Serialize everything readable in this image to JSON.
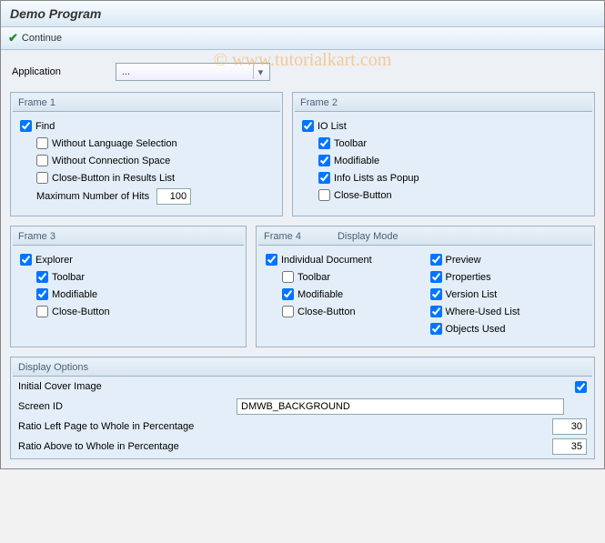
{
  "window_title": "Demo Program",
  "toolbar": {
    "continue_label": "Continue"
  },
  "watermark": "© www.tutorialkart.com",
  "app_row": {
    "label": "Application",
    "value": "..."
  },
  "frame1": {
    "title": "Frame 1",
    "find": "Find",
    "wo_lang": "Without Language Selection",
    "wo_conn": "Without Connection Space",
    "close_results": "Close-Button in Results List",
    "max_hits_label": "Maximum Number of Hits",
    "max_hits_value": "100"
  },
  "frame2": {
    "title": "Frame 2",
    "io_list": "IO List",
    "toolbar": "Toolbar",
    "modifiable": "Modifiable",
    "info_popup": "Info Lists as Popup",
    "close": "Close-Button"
  },
  "frame3": {
    "title": "Frame 3",
    "explorer": "Explorer",
    "toolbar": "Toolbar",
    "modifiable": "Modifiable",
    "close": "Close-Button"
  },
  "frame4": {
    "title": "Frame 4",
    "title2": "Display Mode",
    "indiv_doc": "Individual Document",
    "toolbar": "Toolbar",
    "modifiable": "Modifiable",
    "close": "Close-Button",
    "preview": "Preview",
    "properties": "Properties",
    "version_list": "Version List",
    "where_used": "Where-Used List",
    "objects_used": "Objects Used"
  },
  "display_options": {
    "title": "Display Options",
    "initial_cover": "Initial Cover Image",
    "screen_id_label": "Screen ID",
    "screen_id_value": "DMWB_BACKGROUND",
    "ratio_left_label": "Ratio Left Page to Whole in Percentage",
    "ratio_left_value": "30",
    "ratio_above_label": "Ratio Above to Whole in Percentage",
    "ratio_above_value": "35"
  }
}
